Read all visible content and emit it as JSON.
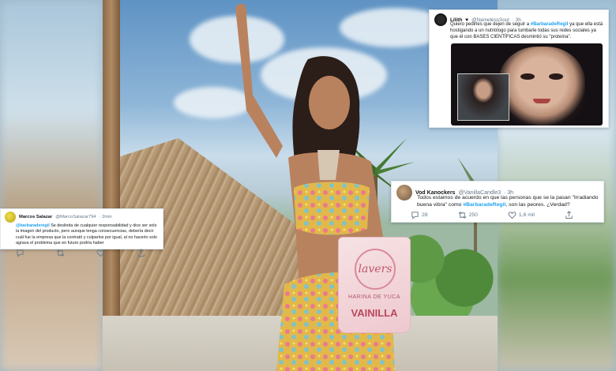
{
  "product": {
    "logo_text": "lavers",
    "label": "HARINA DE YUCA",
    "flavor": "VAINILLA"
  },
  "tweets": [
    {
      "author": "Lilith",
      "author_badge": "♥",
      "handle": "@NamelessSoul",
      "time": "· 3h",
      "text_before": "Quiero pedirles que dejen de seguir a ",
      "hashtag": "#BarbaradeRegil",
      "text_after": " ya que ella está hostigando a un nutriólogo para tumbarle todas sus redes sociales ya que él con BASES CIENTÍFICAS desmintió su \"proteína\".",
      "media": "meme-image"
    },
    {
      "author": "Vod Kanockers",
      "handle": "@VanillaCandle3",
      "time": "· 3h",
      "text_before": "Todos estamos de acuerdo en que las personas que se la pasan \"Irradiando buena vibra\" como ",
      "hashtag": "#BarbaradeRegil",
      "text_after": ", son las peores. ¿Verdad?",
      "replies": "28",
      "retweets": "250",
      "likes": "1,6 mil"
    },
    {
      "author": "Marcos Salazar",
      "handle": "@MarcoSalazar794",
      "time": "· 2min",
      "mention": "@barbaraderegil",
      "text": " Se deslinda de cualquier responsabilidad y dice ser solo la imagen del producto, pero aunque tenga consecuencias, debería decir cuál fue la empresa que la contrató y culparlos por igual, al no hacerlo solo agrava el problema que en futuro podría haber"
    }
  ],
  "icons": {
    "reply": "reply-icon",
    "retweet": "retweet-icon",
    "like": "heart-icon",
    "share": "share-icon"
  },
  "colors": {
    "link": "#1da1f2",
    "muted": "#657786"
  }
}
